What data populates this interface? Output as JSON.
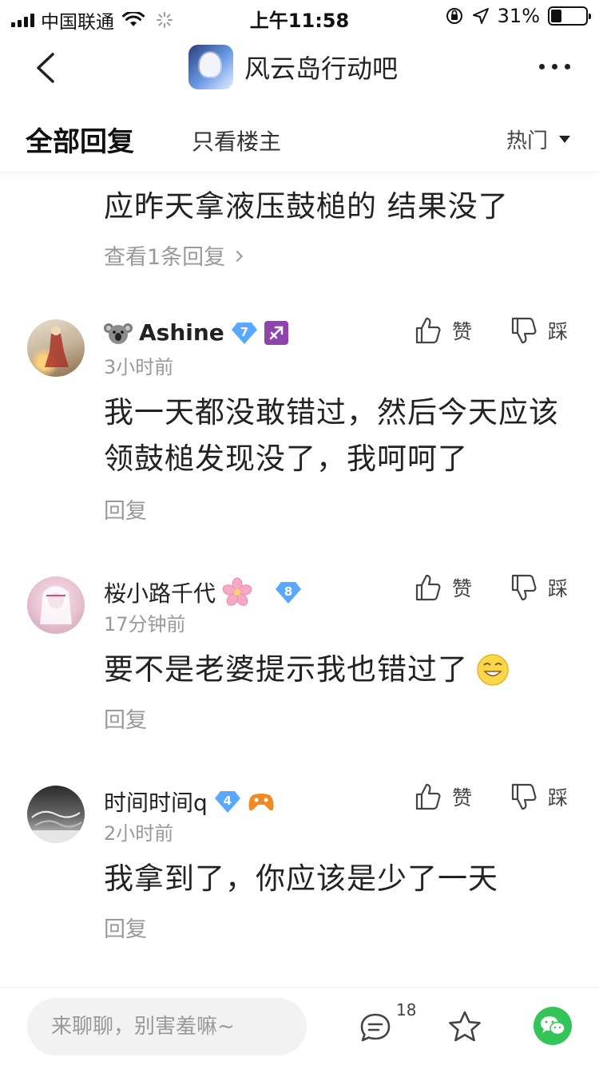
{
  "status_bar": {
    "carrier": "中国联通",
    "time": "上午11:58",
    "battery": "31%",
    "battery_level": 0.31
  },
  "nav": {
    "title": "风云岛行动吧"
  },
  "tabs": {
    "all_replies": "全部回复",
    "owner_only": "只看楼主",
    "sort_label": "热门"
  },
  "top_reply": {
    "text": "应昨天拿液压鼓槌的 结果没了",
    "view_replies": "查看1条回复"
  },
  "comments": [
    {
      "username": "Ashine",
      "level": "7",
      "time": "3小时前",
      "text": "我一天都没敢错过，然后今天应该领鼓槌发现没了，我呵呵了",
      "reply": "回复",
      "like_label": "赞",
      "dislike_label": "踩"
    },
    {
      "username": "桜小路千代",
      "level": "8",
      "time": "17分钟前",
      "text": "要不是老婆提示我也错过了",
      "reply": "回复",
      "like_label": "赞",
      "dislike_label": "踩"
    },
    {
      "username": "时间时间q",
      "level": "4",
      "time": "2小时前",
      "text": "我拿到了，你应该是少了一天",
      "reply": "回复",
      "like_label": "赞",
      "dislike_label": "踩"
    }
  ],
  "bottom_bar": {
    "input_placeholder": "来聊聊，别害羞嘛~",
    "comment_count": "18"
  },
  "colors": {
    "badge_blue": "#5aa7ff",
    "sagittarius_purple": "#8e44ad",
    "wechat_green": "#34c559"
  }
}
